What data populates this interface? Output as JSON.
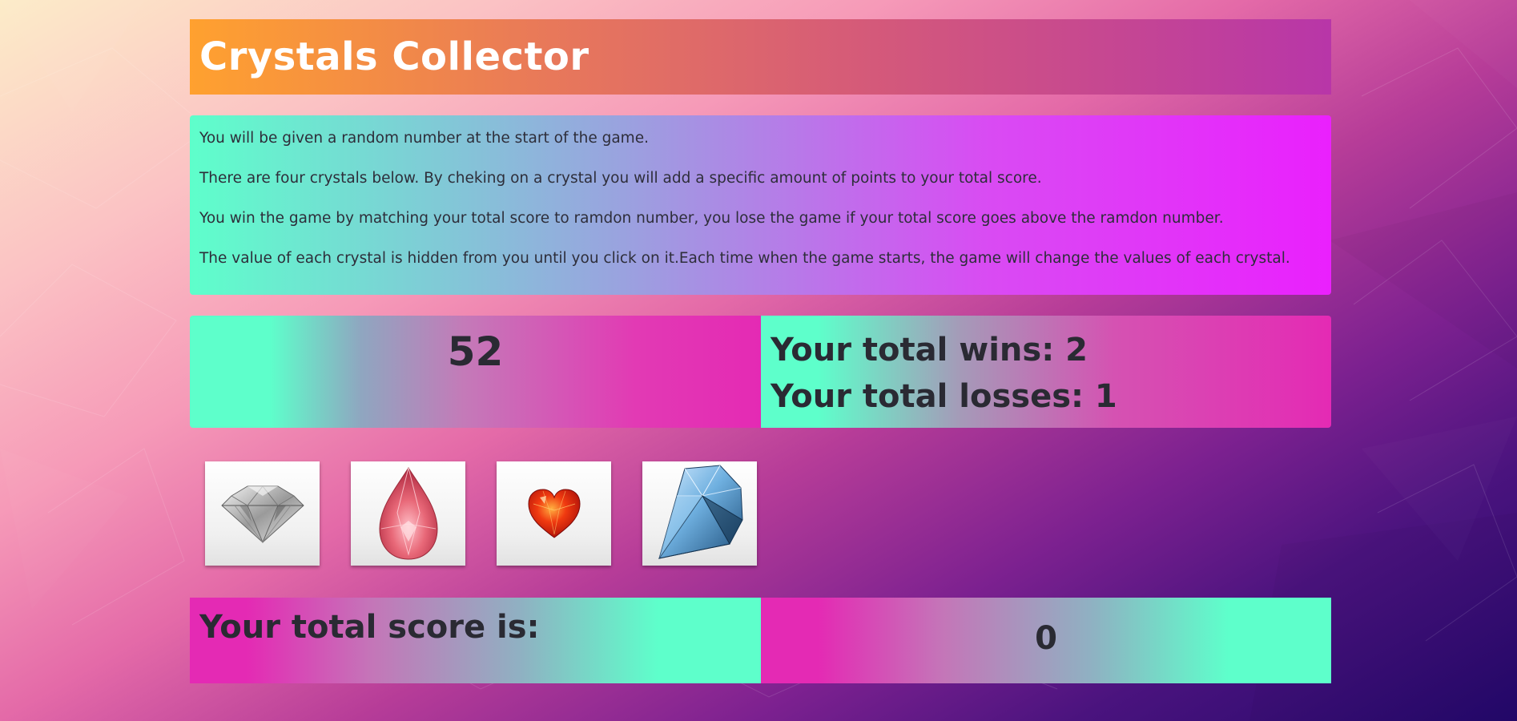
{
  "header": {
    "title": "Crystals Collector"
  },
  "instructions": {
    "line1": "You will be given a random number at the start of the game.",
    "line2": "There are four crystals below. By cheking on a crystal you will add a specific amount of points to your total score.",
    "line3": "You win the game by matching your total score to ramdon number, you lose the game if your total score goes above the ramdon number.",
    "line4": "The value of each crystal is hidden from you until you click on it.Each time when the game starts, the game will change the values of each crystal."
  },
  "game": {
    "random_number": "52",
    "wins_text": "Your total wins: 2",
    "losses_text": "Your total losses: 1",
    "score_label": "Your total score is:",
    "total_score": "0"
  },
  "crystals": [
    {
      "icon": "white-diamond-icon",
      "color": "#d8d8d8"
    },
    {
      "icon": "pink-pear-gem-icon",
      "color": "#e46a7a"
    },
    {
      "icon": "red-heart-gem-icon",
      "color": "#e02a10"
    },
    {
      "icon": "blue-crystal-icon",
      "color": "#5a9ccc"
    }
  ],
  "colors": {
    "aqua": "#5effcb",
    "magenta": "#e42ab4",
    "title_orange": "#ffa12f",
    "title_purple": "#b836a8",
    "text_dark": "#2a2a33"
  }
}
